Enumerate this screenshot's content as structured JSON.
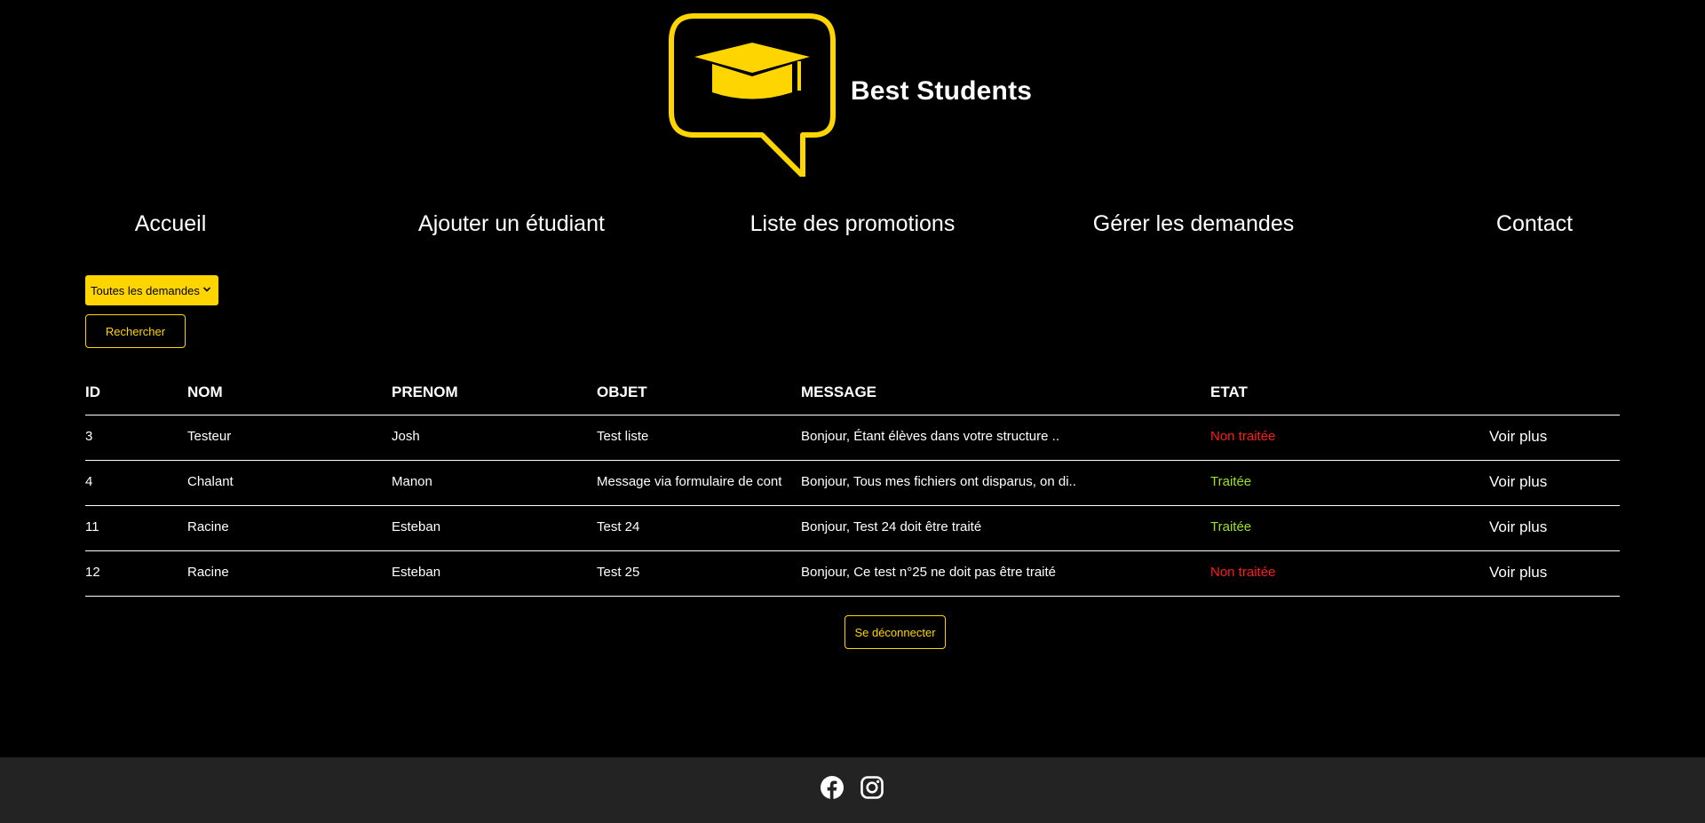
{
  "brand": {
    "name": "Best Students"
  },
  "colors": {
    "accent": "#ffd500",
    "background": "#000000",
    "footer": "#232323",
    "status_pending": "#ff1a1a",
    "status_done": "#9be21e"
  },
  "nav": {
    "items": [
      {
        "label": "Accueil"
      },
      {
        "label": "Ajouter un étudiant"
      },
      {
        "label": "Liste des promotions"
      },
      {
        "label": "Gérer les demandes"
      },
      {
        "label": "Contact"
      }
    ]
  },
  "filter": {
    "selected": "Toutes les demandes",
    "icon": "chevron-down-icon"
  },
  "search": {
    "label": "Rechercher"
  },
  "table": {
    "headers": {
      "id": "ID",
      "nom": "NOM",
      "prenom": "PRENOM",
      "objet": "OBJET",
      "message": "MESSAGE",
      "etat": "ETAT"
    },
    "rows": [
      {
        "id": "3",
        "nom": "Testeur",
        "prenom": "Josh",
        "objet": "Test liste",
        "message": "Bonjour, Étant élèves dans votre structure ..",
        "etat": "Non traitée",
        "action": "Voir plus"
      },
      {
        "id": "4",
        "nom": "Chalant",
        "prenom": "Manon",
        "objet": "Message via formulaire de cont",
        "message": "Bonjour, Tous mes fichiers ont disparus, on di..",
        "etat": "Traitée",
        "action": "Voir plus"
      },
      {
        "id": "11",
        "nom": "Racine",
        "prenom": "Esteban",
        "objet": "Test 24",
        "message": "Bonjour, Test 24 doit être traité",
        "etat": "Traitée",
        "action": "Voir plus"
      },
      {
        "id": "12",
        "nom": "Racine",
        "prenom": "Esteban",
        "objet": "Test 25",
        "message": "Bonjour, Ce test n°25 ne doit pas être traité",
        "etat": "Non traitée",
        "action": "Voir plus"
      }
    ]
  },
  "logout": {
    "label": "Se déconnecter"
  },
  "footer": {
    "icons": [
      "facebook-icon",
      "instagram-icon"
    ]
  }
}
